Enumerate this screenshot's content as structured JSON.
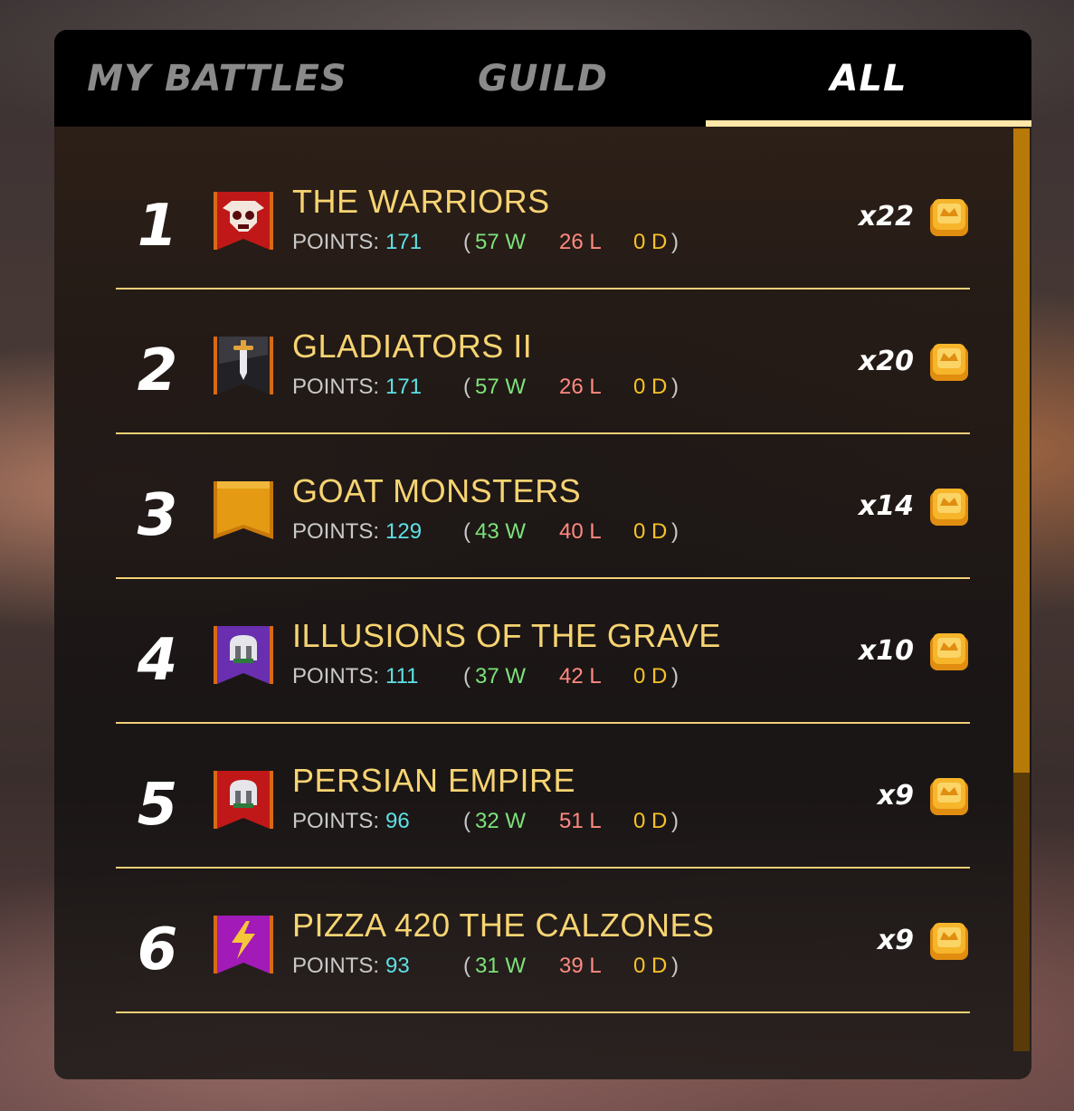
{
  "tabs": [
    {
      "label": "MY BATTLES",
      "active": false
    },
    {
      "label": "GUILD",
      "active": false
    },
    {
      "label": "ALL",
      "active": true
    }
  ],
  "points_label": "POINTS:",
  "paren_open": "(",
  "paren_close": ")",
  "colors": {
    "accent": "#f7d472",
    "divider": "#f2cf77",
    "points": "#5ee0e6",
    "wins": "#7de27a",
    "losses": "#ff8a80",
    "draws": "#f7c229",
    "scroll_thumb": "#b77a08"
  },
  "rows": [
    {
      "rank": "1",
      "name": "THE WARRIORS",
      "points": "171",
      "wins": "57 W",
      "losses": "26 L",
      "draws": "0 D",
      "multiplier": "x22",
      "banner_icon": "skull-crest-red-banner",
      "reward_icon": "reward-chest-icon"
    },
    {
      "rank": "2",
      "name": "GLADIATORS II",
      "points": "171",
      "wins": "57 W",
      "losses": "26 L",
      "draws": "0 D",
      "multiplier": "x20",
      "banner_icon": "sword-black-banner",
      "reward_icon": "reward-chest-icon"
    },
    {
      "rank": "3",
      "name": "GOAT MONSTERS",
      "points": "129",
      "wins": "43 W",
      "losses": "40 L",
      "draws": "0 D",
      "multiplier": "x14",
      "banner_icon": "plain-gold-banner",
      "reward_icon": "reward-chest-icon"
    },
    {
      "rank": "4",
      "name": "ILLUSIONS OF THE GRAVE",
      "points": "111",
      "wins": "37 W",
      "losses": "42 L",
      "draws": "0 D",
      "multiplier": "x10",
      "banner_icon": "helmet-purple-banner",
      "reward_icon": "reward-chest-icon"
    },
    {
      "rank": "5",
      "name": "PERSIAN EMPIRE",
      "points": "96",
      "wins": "32 W",
      "losses": "51 L",
      "draws": "0 D",
      "multiplier": "x9",
      "banner_icon": "helmet-red-banner",
      "reward_icon": "reward-chest-icon"
    },
    {
      "rank": "6",
      "name": "PIZZA 420 THE CALZONES",
      "points": "93",
      "wins": "31 W",
      "losses": "39 L",
      "draws": "0 D",
      "multiplier": "x9",
      "banner_icon": "lightning-magenta-banner",
      "reward_icon": "reward-chest-icon"
    }
  ]
}
